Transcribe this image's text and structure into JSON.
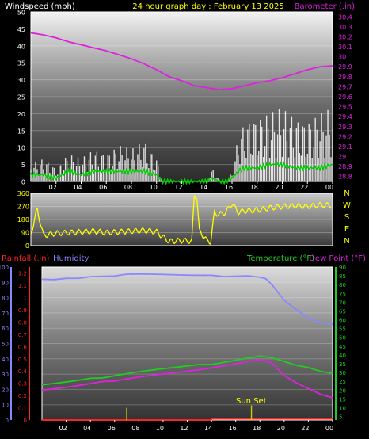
{
  "header": {
    "windspeed_label": "Windspeed (mph)",
    "title": "24 hour graph day : February 13 2025",
    "barometer_label": "Barometer (.in)"
  },
  "colors": {
    "windspeed": "#ffffff",
    "gust": "#ffffff",
    "avg": "#00cc00",
    "barometer": "#dd22dd",
    "direction": "#ffff00",
    "humidity": "#8888ff",
    "temperature": "#22cc22",
    "dewpoint": "#dd22dd",
    "rainfall": "#ff2222",
    "sunset": "#cccc00",
    "frame": "#ffffff",
    "yellow_text": "#ffff00"
  },
  "x_axis": {
    "ticks": [
      "02",
      "04",
      "06",
      "08",
      "10",
      "12",
      "14",
      "16",
      "18",
      "20",
      "22",
      "00"
    ],
    "tick_hours": [
      2,
      4,
      6,
      8,
      10,
      12,
      14,
      16,
      18,
      20,
      22,
      24
    ]
  },
  "panel_wind": {
    "left_axis": [
      0,
      5,
      10,
      15,
      20,
      25,
      30,
      35,
      40,
      45,
      50
    ],
    "right_axis": [
      "28.8",
      "28.9",
      "29",
      "29.1",
      "29.2",
      "29.3",
      "29.4",
      "29.5",
      "29.6",
      "29.7",
      "29.8",
      "29.9",
      "30",
      "30.1",
      "30.2",
      "30.3",
      "30.4"
    ]
  },
  "panel_direction": {
    "left_axis": [
      0,
      90,
      180,
      270,
      360
    ],
    "compass_letters": [
      "N",
      "W",
      "S",
      "E",
      "N"
    ]
  },
  "panel_temp": {
    "rainfall_label": "Rainfall (.in)",
    "humidity_label": "Humidity",
    "temperature_label": "Temperature (°F)",
    "dewpoint_label": "Dew Point (°F)",
    "humidity_axis": [
      0,
      10,
      20,
      30,
      40,
      50,
      60,
      70,
      80,
      90,
      100
    ],
    "rain_axis": [
      "0",
      "0.1",
      "0.2",
      "0.3",
      "0.4",
      "0.5",
      "0.6",
      "0.7",
      "0.8",
      "0.9",
      "1",
      "1.1",
      "1.2"
    ],
    "temp_axis": [
      5,
      10,
      15,
      20,
      25,
      30,
      35,
      40,
      45,
      50,
      55,
      60,
      65,
      70,
      75,
      80,
      85,
      90
    ],
    "sunset_label": "Sun Set"
  },
  "chart_data": [
    {
      "type": "line",
      "title": "24 hour graph day : February 13 2025",
      "ylabel": "Windspeed (mph)",
      "y2label": "Barometer (.in)",
      "ylim": [
        0,
        50
      ],
      "y2lim": [
        28.75,
        30.45
      ],
      "xlim_hours": [
        0,
        24
      ],
      "series": [
        {
          "name": "Barometer (.in)",
          "axis": "right",
          "x": [
            0,
            1,
            2,
            3,
            4,
            5,
            6,
            7,
            8,
            9,
            10,
            11,
            12,
            13,
            14,
            15,
            16,
            17,
            18,
            19,
            20,
            21,
            22,
            23,
            24
          ],
          "values": [
            30.24,
            30.22,
            30.19,
            30.15,
            30.12,
            30.09,
            30.06,
            30.02,
            29.98,
            29.93,
            29.87,
            29.8,
            29.76,
            29.71,
            29.69,
            29.67,
            29.68,
            29.71,
            29.74,
            29.76,
            29.79,
            29.83,
            29.87,
            29.9,
            29.91
          ]
        },
        {
          "name": "",
          "axis": "left",
          "x": [
            0,
            1,
            2,
            3,
            4,
            5,
            6,
            7,
            8,
            9,
            10,
            10.5,
            11,
            12,
            13,
            14,
            14.5,
            15,
            15.5,
            16,
            16.5,
            17,
            18,
            19,
            20,
            21,
            22,
            23,
            24
          ],
          "values": [
            4,
            5,
            3,
            6,
            5,
            7,
            6,
            8,
            7,
            9,
            5,
            0,
            0,
            0,
            0,
            0,
            3,
            0,
            0,
            2,
            10,
            13,
            14,
            15,
            16,
            14,
            13,
            15,
            16
          ]
        },
        {
          "name": "",
          "axis": "left",
          "x": [
            0,
            1,
            2,
            3,
            4,
            5,
            6,
            7,
            8,
            9,
            10,
            10.5,
            11,
            12,
            13,
            14,
            14.5,
            15,
            15.5,
            16,
            16.5,
            17,
            18,
            19,
            20,
            21,
            22,
            23,
            24
          ],
          "values": [
            2,
            2,
            1,
            3,
            2,
            3,
            3,
            3,
            3,
            3,
            2,
            0,
            0,
            0,
            0,
            0,
            1,
            0,
            0,
            1,
            3,
            4,
            4,
            5,
            5,
            4,
            4,
            4,
            5
          ]
        }
      ]
    },
    {
      "type": "scatter",
      "ylabel": "",
      "ylim": [
        0,
        360
      ],
      "xlim_hours": [
        0,
        24
      ],
      "series": [
        {
          "name": "",
          "x": [
            0,
            0.5,
            1,
            2,
            3,
            4,
            5,
            6,
            7,
            8,
            9,
            10,
            10.5,
            11,
            12,
            12.8,
            13,
            13.2,
            13.4,
            13.6,
            13.8,
            14,
            14.3,
            14.6,
            15,
            15.5,
            16,
            16.5,
            17,
            18,
            19,
            20,
            21,
            22,
            23,
            24
          ],
          "values": [
            80,
            250,
            70,
            85,
            90,
            95,
            100,
            90,
            95,
            100,
            105,
            95,
            60,
            30,
            35,
            30,
            350,
            335,
            100,
            80,
            60,
            35,
            25,
            225,
            215,
            230,
            290,
            230,
            240,
            245,
            260,
            270,
            275,
            270,
            280,
            278
          ]
        }
      ]
    },
    {
      "type": "line",
      "ylabel": "Humidity",
      "y2label": "Temperature (°F)",
      "ylim": [
        0,
        100
      ],
      "y2lim": [
        3,
        90
      ],
      "xlim_hours": [
        0,
        24
      ],
      "series": [
        {
          "name": "Humidity",
          "axis": "humidity",
          "x": [
            0,
            1,
            2,
            3,
            4,
            5,
            6,
            7,
            8,
            9,
            10,
            11,
            12,
            13,
            14,
            15,
            16,
            17,
            18,
            18.5,
            19,
            20,
            21,
            22,
            23,
            24
          ],
          "values": [
            92,
            92,
            93,
            93,
            94,
            94,
            94,
            95,
            95,
            95,
            95,
            95,
            95,
            95,
            95,
            94,
            94,
            94,
            93,
            92,
            88,
            78,
            72,
            67,
            64,
            63
          ]
        },
        {
          "name": "Temperature (°F)",
          "axis": "temp",
          "x": [
            0,
            1,
            2,
            3,
            4,
            5,
            6,
            7,
            8,
            9,
            10,
            11,
            12,
            13,
            14,
            15,
            16,
            17,
            18,
            19,
            20,
            21,
            22,
            23,
            24
          ],
          "values": [
            23,
            24,
            25,
            26,
            27,
            27,
            28,
            29,
            30,
            31,
            32,
            33,
            34,
            35,
            35,
            36,
            37,
            38,
            39,
            38,
            36,
            34,
            33,
            31,
            30
          ]
        },
        {
          "name": "Dew Point (°F)",
          "axis": "temp",
          "x": [
            0,
            1,
            2,
            3,
            4,
            5,
            6,
            7,
            8,
            9,
            10,
            11,
            12,
            13,
            14,
            15,
            16,
            17,
            18,
            19,
            20,
            21,
            22,
            23,
            24
          ],
          "values": [
            20,
            21,
            22,
            23,
            24,
            25,
            25,
            26,
            27,
            28,
            29,
            30,
            31,
            32,
            33,
            34,
            35,
            36,
            37,
            35,
            28,
            24,
            21,
            18,
            16
          ]
        },
        {
          "name": "Rainfall (.in)",
          "axis": "rain",
          "x": [
            0,
            14,
            14,
            24
          ],
          "values": [
            0,
            0,
            0.01,
            0.01
          ]
        }
      ]
    }
  ]
}
